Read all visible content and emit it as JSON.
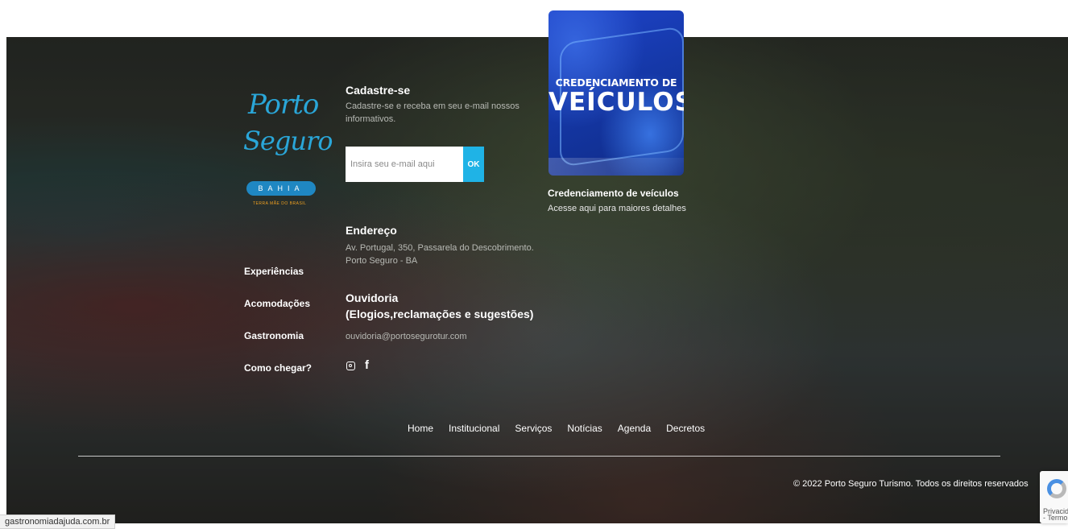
{
  "logo": {
    "line1": "Porto",
    "line2": "Seguro",
    "region": "BAHIA",
    "tagline": "TERRA MÃE DO BRASIL"
  },
  "nav_left": [
    "Experiências",
    "Acomodações",
    "Gastronomia",
    "Como chegar?"
  ],
  "signup": {
    "title": "Cadastre-se",
    "description": "Cadastre-se e receba em seu e-mail nossos informativos.",
    "email_placeholder": "Insira seu e-mail aqui",
    "email_value": "",
    "submit_label": "OK"
  },
  "address": {
    "title": "Endereço",
    "line1": "Av. Portugal, 350, Passarela do Descobrimento.",
    "line2": "Porto Seguro - BA"
  },
  "ombudsman": {
    "title": "Ouvidoria",
    "subtitle": "(Elogios,reclamações e sugestões)",
    "email": "ouvidoria@portosegurotur.com"
  },
  "social": {
    "icons": [
      "instagram-icon",
      "facebook-icon"
    ],
    "facebook_glyph": "f"
  },
  "vehicle_banner": {
    "line1": "CREDENCIAMENTO DE",
    "line2": "VEÍCULOS",
    "caption_title": "Credenciamento de veículos",
    "caption_text": "Acesse aqui para maiores detalhes"
  },
  "nav_bottom": [
    "Home",
    "Institucional",
    "Serviços",
    "Notícias",
    "Agenda",
    "Decretos"
  ],
  "copyright": "© 2022 Porto Seguro Turismo. Todos os direitos reservados",
  "status_bar_url": "gastronomiadajuda.com.br",
  "recaptcha": {
    "label1": "Privacid",
    "label2": "- Termo"
  },
  "colors": {
    "accent": "#1fb3e6",
    "logo_blue": "#2aa6d8",
    "banner_blue": "#1e43c9"
  }
}
